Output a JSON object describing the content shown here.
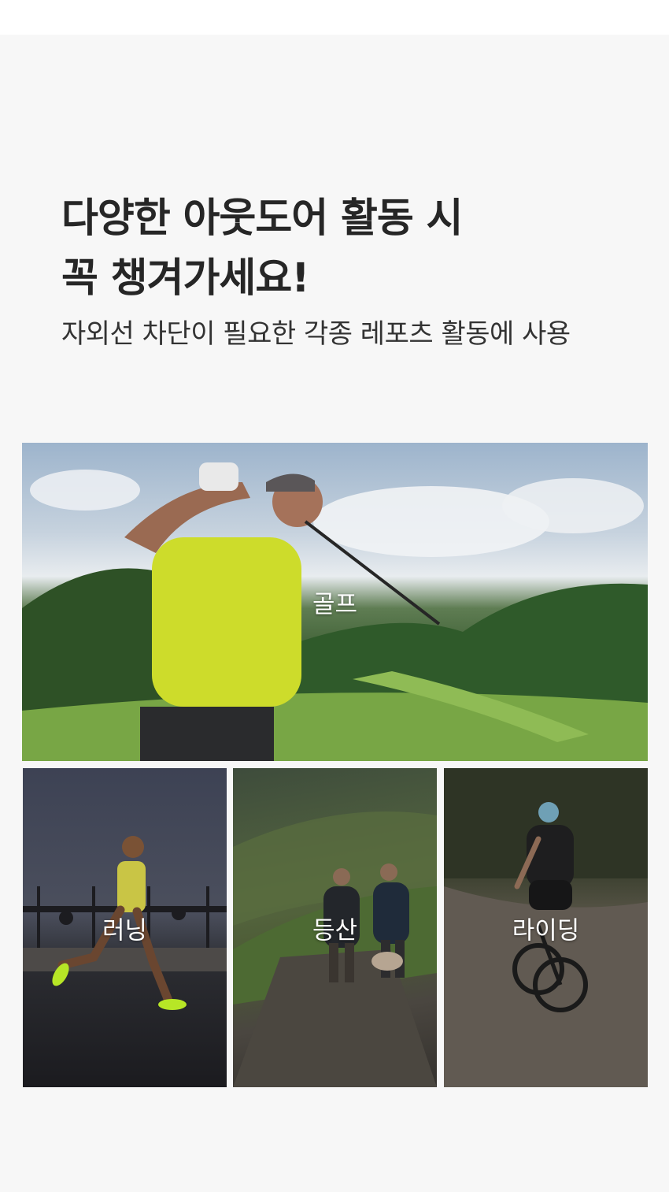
{
  "headline": {
    "line1": "다양한 아웃도어 활동 시",
    "line2": "꼭 챙겨가세요!"
  },
  "subtitle": "자외선 차단이 필요한 각종 레포츠 활동에 사용",
  "activities": [
    {
      "label": "골프",
      "photo": "golfer-swinging-on-green-course"
    },
    {
      "label": "러닝",
      "photo": "runner-on-waterfront-path"
    },
    {
      "label": "등산",
      "photo": "hikers-with-dog-on-mountain-trail"
    },
    {
      "label": "라이딩",
      "photo": "cyclist-on-gravel-road"
    }
  ],
  "colors": {
    "page_background": "#f7f7f7",
    "headline_text": "#262626",
    "subtitle_text": "#333333",
    "label_text": "#ffffff"
  }
}
